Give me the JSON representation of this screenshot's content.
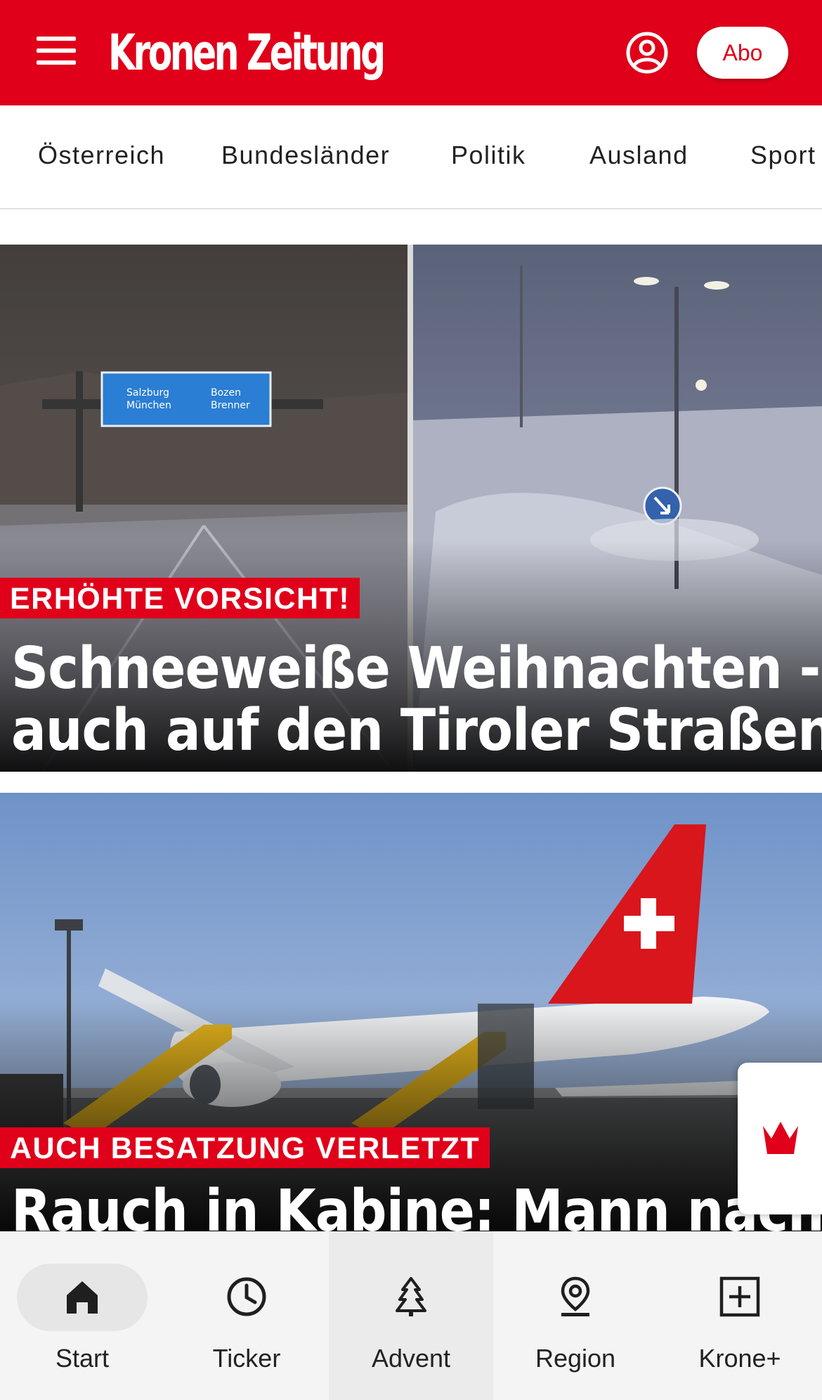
{
  "header": {
    "logo": "Kronen Zeitung",
    "abo_label": "Abo",
    "brand_color": "#e0001a",
    "icons": [
      "menu-icon",
      "account-icon"
    ]
  },
  "categories": [
    "Österreich",
    "Bundesländer",
    "Politik",
    "Ausland",
    "Sport"
  ],
  "articles": [
    {
      "kicker": "ERHÖHTE VORSICHT!",
      "headline_line1": "Schneeweiße Weihnachten -",
      "headline_line2": "auch auf den Tiroler Straßen",
      "sign_text": [
        "Salzburg",
        "München",
        "Bozen",
        "Brenner"
      ]
    },
    {
      "kicker": "AUCH BESATZUNG VERLETZT",
      "headline_line1": "Rauch in Kabine: Mann nach"
    }
  ],
  "krone_tab_icon": "crown-icon",
  "bottom_nav": [
    {
      "label": "Start",
      "icon": "home-icon",
      "selected": true
    },
    {
      "label": "Ticker",
      "icon": "clock-icon"
    },
    {
      "label": "Advent",
      "icon": "tree-icon"
    },
    {
      "label": "Region",
      "icon": "location-pin-icon"
    },
    {
      "label": "Krone+",
      "icon": "plus-box-icon"
    }
  ]
}
